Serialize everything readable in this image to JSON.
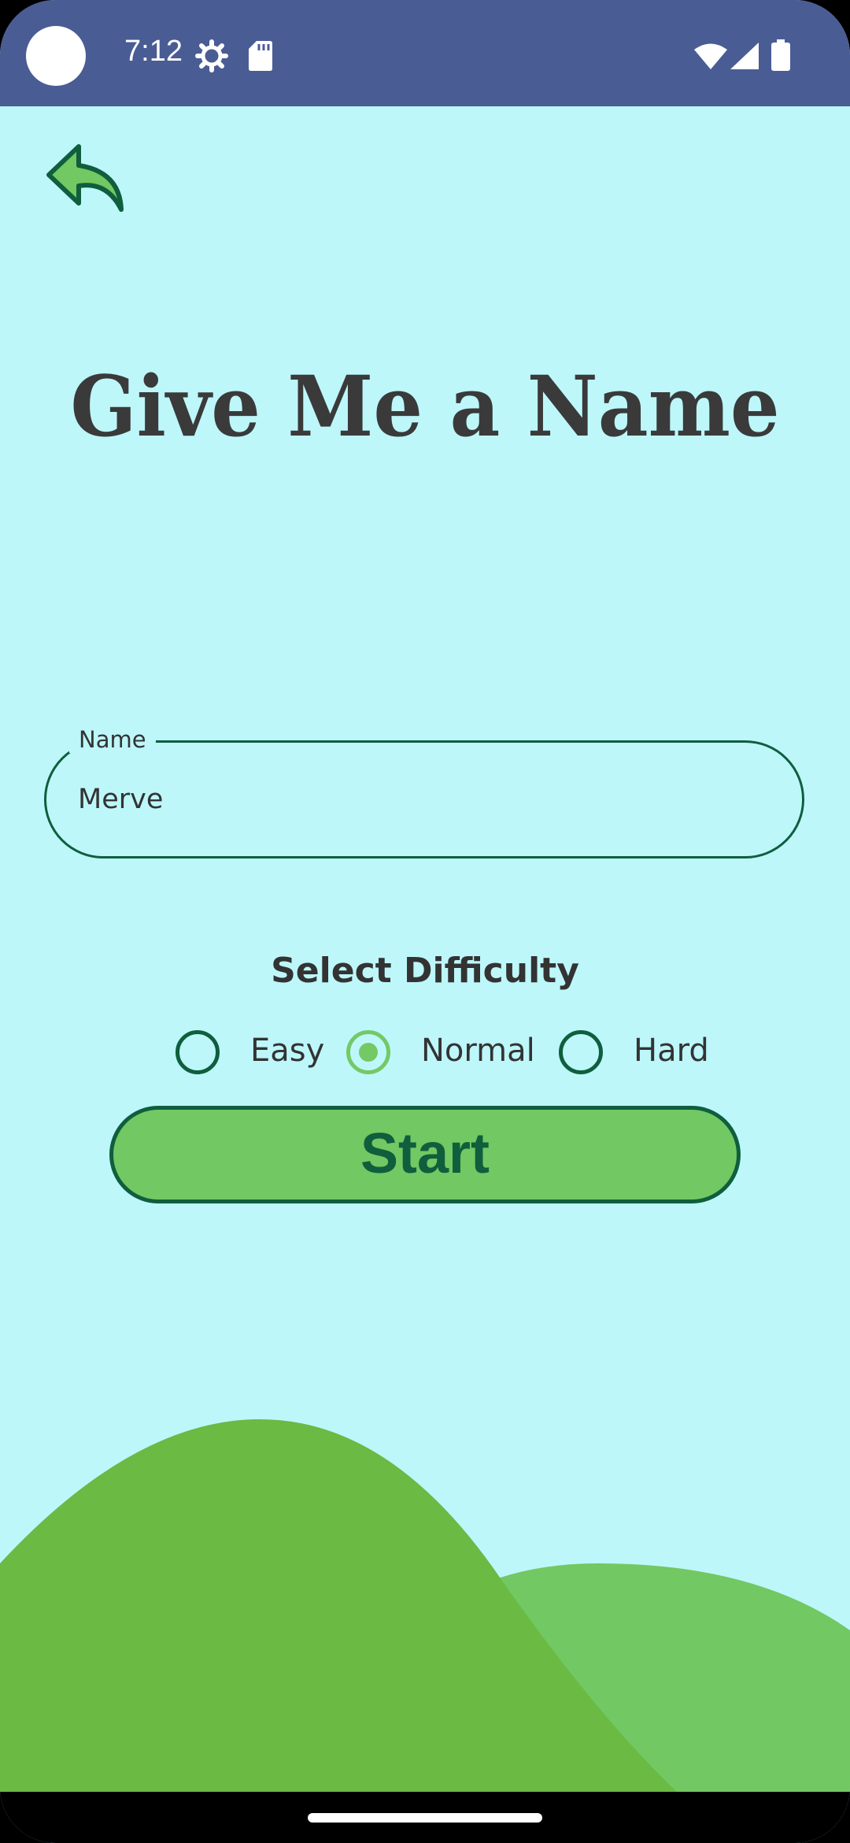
{
  "status_bar": {
    "time": "7:12",
    "icons": [
      "settings-icon",
      "sd-card-icon",
      "wifi-icon",
      "signal-icon",
      "battery-icon"
    ],
    "color": "#4a5c94"
  },
  "back_button": {
    "icon": "back-arrow-icon",
    "color": "#72c862"
  },
  "title": "Give Me a Name",
  "name_field": {
    "label": "Name",
    "value": "Merve"
  },
  "difficulty": {
    "heading": "Select Difficulty",
    "options": [
      {
        "label": "Easy",
        "selected": false
      },
      {
        "label": "Normal",
        "selected": true
      },
      {
        "label": "Hard",
        "selected": false
      }
    ]
  },
  "start_button": {
    "label": "Start",
    "color": "#72c862"
  },
  "colors": {
    "background": "#bdf7fa",
    "accent_dark": "#0f5e3d",
    "hill_dark": "#6aba44",
    "hill_light": "#72c862"
  }
}
